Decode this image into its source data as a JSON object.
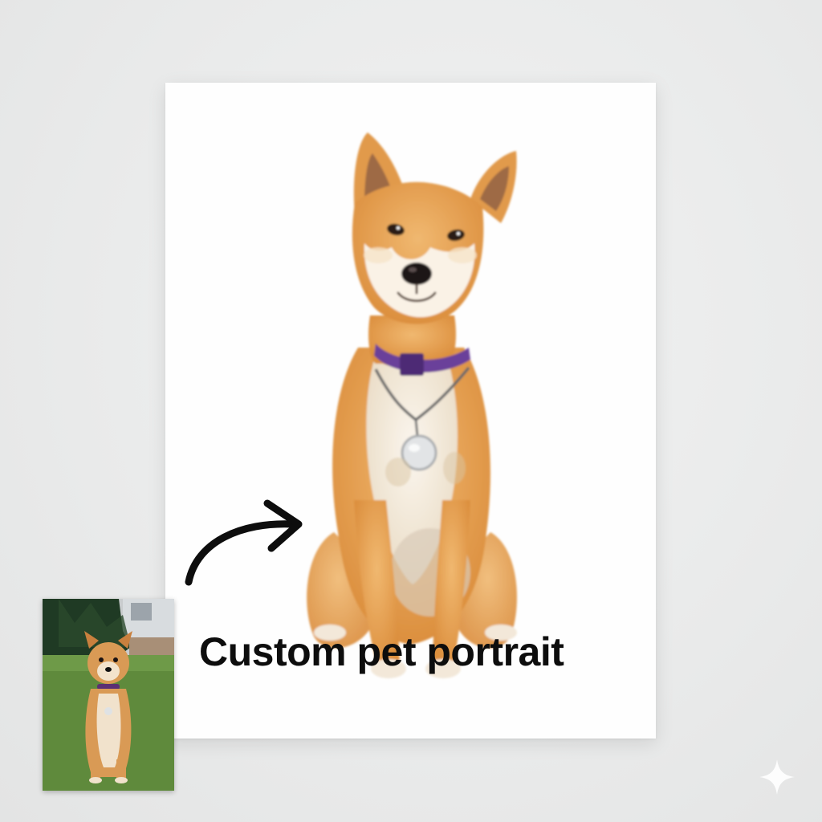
{
  "caption": {
    "text": "Custom pet portrait"
  },
  "colors": {
    "background": "#e9eaea",
    "card": "#fefefe",
    "caption_text": "#0d0d0d",
    "fur_orange": "#e7a257",
    "fur_cream": "#f6ecdf",
    "collar_purple": "#6a3f9a",
    "grass": "#5f8a3c",
    "trees": "#1f3a24"
  },
  "icons": {
    "arrow": "curved-arrow-icon",
    "sparkle": "sparkle-icon"
  }
}
